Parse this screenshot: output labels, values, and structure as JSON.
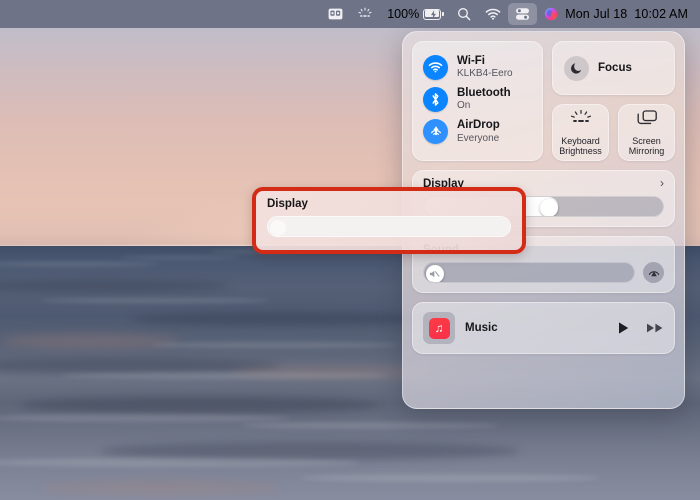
{
  "menubar": {
    "screen_icon": "screen-record-icon",
    "keyboard_brightness_icon": "keyboard-brightness-icon",
    "battery_percent": "100%",
    "battery_icon": "battery-charging-icon",
    "search_icon": "search-icon",
    "wifi_icon": "wifi-icon",
    "control_center_icon": "control-center-icon",
    "siri_icon": "siri-icon",
    "date": "Mon Jul 18",
    "time": "10:02 AM"
  },
  "control_center": {
    "connectivity": [
      {
        "title": "Wi-Fi",
        "subtitle": "KLKB4-Eero",
        "icon": "wifi-icon"
      },
      {
        "title": "Bluetooth",
        "subtitle": "On",
        "icon": "bluetooth-icon"
      },
      {
        "title": "AirDrop",
        "subtitle": "Everyone",
        "icon": "airdrop-icon"
      }
    ],
    "focus": {
      "label": "Focus",
      "icon": "moon-icon"
    },
    "tiles": [
      {
        "label": "Keyboard\nBrightness",
        "line1": "Keyboard",
        "line2": "Brightness",
        "icon": "keyboard-brightness-icon"
      },
      {
        "label": "Screen\nMirroring",
        "line1": "Screen",
        "line2": "Mirroring",
        "icon": "screen-mirroring-icon"
      }
    ],
    "display": {
      "title": "Display",
      "value_percent": 55,
      "chevron": "›"
    },
    "sound": {
      "title": "Sound",
      "value_percent": 0,
      "output_icon": "airplay-audio-icon",
      "knob_icon": "speaker-mute-icon"
    },
    "music": {
      "label": "Music",
      "app_icon": "music-note-icon",
      "play_icon": "play-icon",
      "next_icon": "fast-forward-icon"
    }
  },
  "annotation": {
    "title": "Display",
    "value_percent": 3,
    "border_color": "#d32b16",
    "name": "display-section-highlight"
  },
  "colors": {
    "menubar_bg": "#6e7387",
    "accent_blue": "#0a84ff",
    "annotation_red": "#d32b16",
    "music_red": "#fc3c44"
  }
}
